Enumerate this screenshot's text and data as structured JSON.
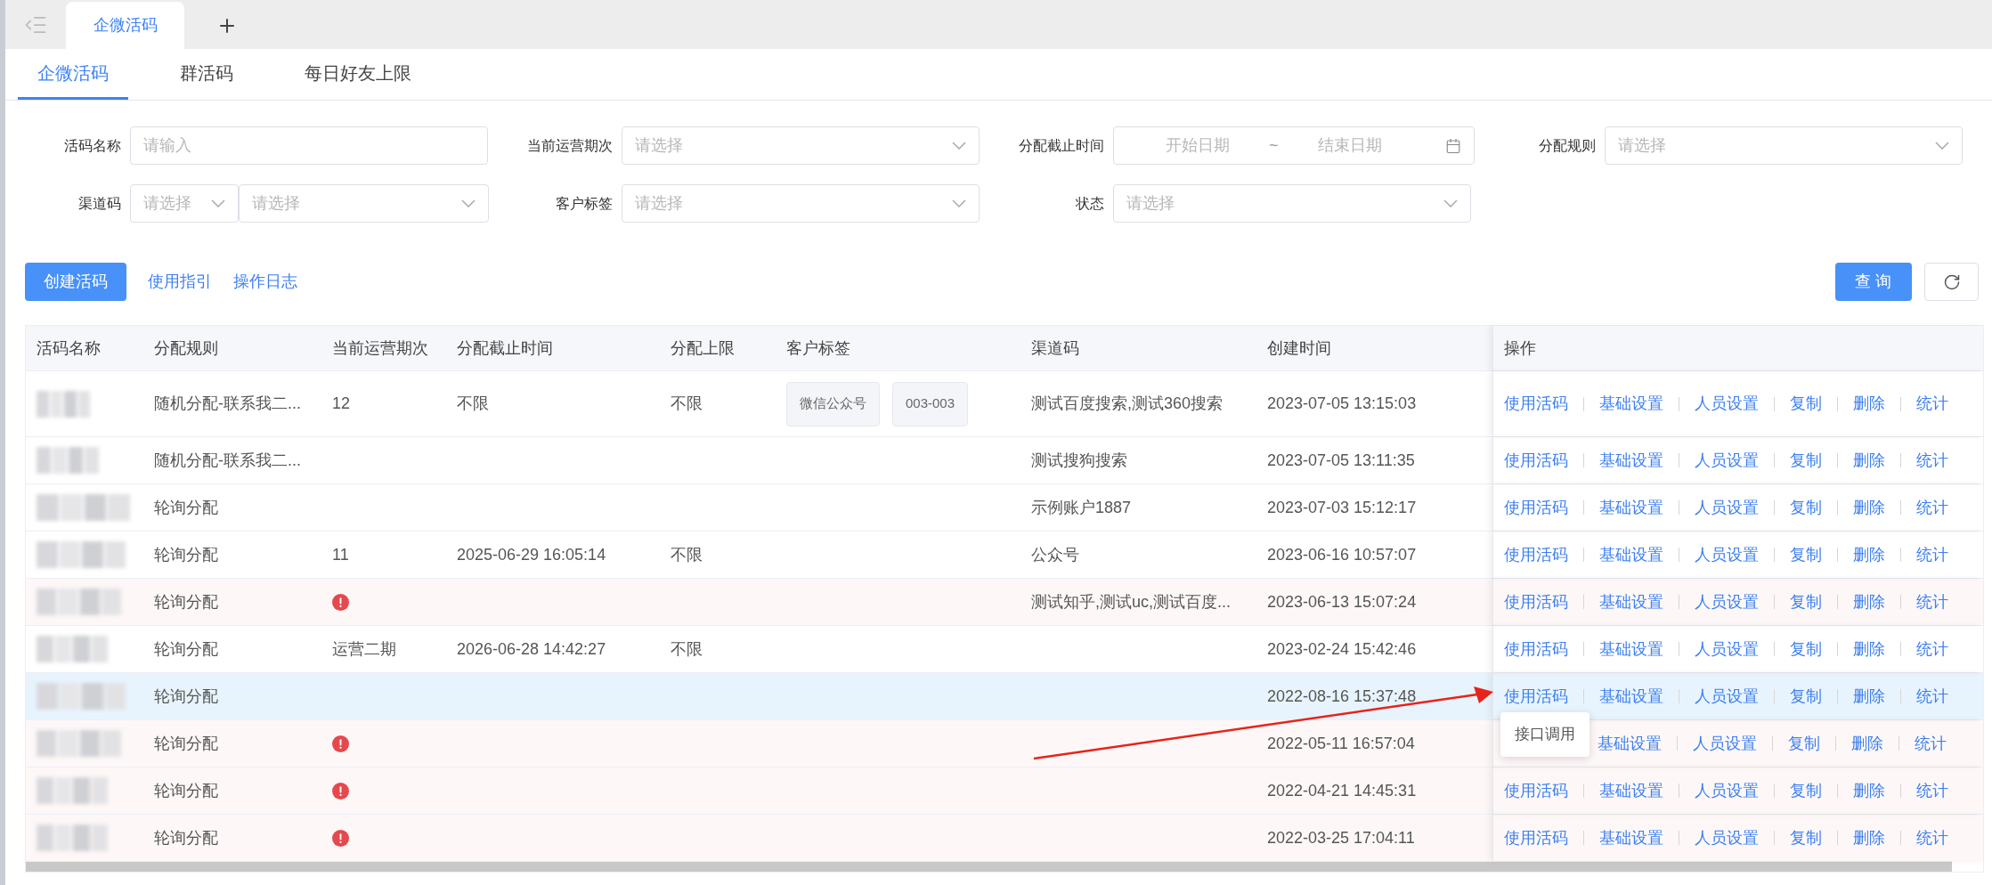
{
  "window_tabs": [
    {
      "label": "企微活码",
      "selected": true
    }
  ],
  "sub_tabs": [
    {
      "label": "企微活码",
      "selected": true
    },
    {
      "label": "群活码",
      "selected": false
    },
    {
      "label": "每日好友上限",
      "selected": false
    }
  ],
  "filters": [
    {
      "kind": "input",
      "label": "活码名称",
      "placeholder": "请输入"
    },
    {
      "kind": "select",
      "label": "当前运营期次",
      "placeholder": "请选择"
    },
    {
      "kind": "daterange",
      "label": "分配截止时间",
      "start_placeholder": "开始日期",
      "separator": "~",
      "end_placeholder": "结束日期"
    },
    {
      "kind": "select",
      "label": "分配规则",
      "placeholder": "请选择"
    },
    {
      "kind": "cascade",
      "label": "渠道码",
      "placeholder": "请选择",
      "second_placeholder": "请选择"
    },
    {
      "kind": "select",
      "label": "客户标签",
      "placeholder": "请选择"
    },
    {
      "kind": "select",
      "label": "状态",
      "placeholder": "请选择"
    }
  ],
  "toolbar": {
    "create_button": "创建活码",
    "links": [
      "使用指引",
      "操作日志"
    ],
    "query_button": "查 询"
  },
  "table": {
    "columns": [
      "活码名称",
      "分配规则",
      "当前运营期次",
      "分配截止时间",
      "分配上限",
      "客户标签",
      "渠道码",
      "创建时间",
      "操作"
    ],
    "rows": [
      {
        "rule": "随机分配-联系我二...",
        "period": "12",
        "warning": false,
        "deadline": "不限",
        "limit": "不限",
        "tags": [
          "微信公众号",
          "003-003"
        ],
        "channel": "测试百度搜索,测试360搜索",
        "created": "2023-07-05 13:15:03",
        "highlighted": false,
        "actions": [
          "使用活码",
          "基础设置",
          "人员设置",
          "复制",
          "删除",
          "统计"
        ]
      },
      {
        "rule": "随机分配-联系我二...",
        "warning": false,
        "channel": "测试搜狗搜索",
        "created": "2023-07-05 13:11:35",
        "highlighted": false,
        "actions": [
          "使用活码",
          "基础设置",
          "人员设置",
          "复制",
          "删除",
          "统计"
        ]
      },
      {
        "rule": "轮询分配",
        "warning": false,
        "channel": "示例账户1887",
        "created": "2023-07-03 15:12:17",
        "highlighted": false,
        "actions": [
          "使用活码",
          "基础设置",
          "人员设置",
          "复制",
          "删除",
          "统计"
        ]
      },
      {
        "rule": "轮询分配",
        "period": "11",
        "warning": false,
        "deadline": "2025-06-29 16:05:14",
        "limit": "不限",
        "channel": "公众号",
        "created": "2023-06-16 10:57:07",
        "highlighted": false,
        "actions": [
          "使用活码",
          "基础设置",
          "人员设置",
          "复制",
          "删除",
          "统计"
        ]
      },
      {
        "rule": "轮询分配",
        "warning": true,
        "channel": "测试知乎,测试uc,测试百度...",
        "created": "2023-06-13 15:07:24",
        "highlighted": false,
        "actions": [
          "使用活码",
          "基础设置",
          "人员设置",
          "复制",
          "删除",
          "统计"
        ]
      },
      {
        "rule": "轮询分配",
        "period": "运营二期",
        "warning": false,
        "deadline": "2026-06-28 14:42:27",
        "limit": "不限",
        "created": "2023-02-24 15:42:46",
        "highlighted": false,
        "actions": [
          "使用活码",
          "基础设置",
          "人员设置",
          "复制",
          "删除",
          "统计"
        ]
      },
      {
        "rule": "轮询分配",
        "warning": false,
        "created": "2022-08-16 15:37:48",
        "highlighted": true,
        "tooltip": "接口调用",
        "actions": [
          "使用活码",
          "基础设置",
          "人员设置",
          "复制",
          "删除",
          "统计"
        ]
      },
      {
        "rule": "轮询分配",
        "warning": true,
        "created": "2022-05-11 16:57:04",
        "highlighted": false,
        "actions": [
          "基础设置",
          "人员设置",
          "复制",
          "删除",
          "统计"
        ]
      },
      {
        "rule": "轮询分配",
        "warning": true,
        "created": "2022-04-21 14:45:31",
        "highlighted": false,
        "actions": [
          "使用活码",
          "基础设置",
          "人员设置",
          "复制",
          "删除",
          "统计"
        ]
      },
      {
        "rule": "轮询分配",
        "warning": true,
        "created": "2022-03-25 17:04:11",
        "highlighted": false,
        "actions": [
          "使用活码",
          "基础设置",
          "人员设置",
          "复制",
          "删除",
          "统计"
        ]
      }
    ]
  }
}
